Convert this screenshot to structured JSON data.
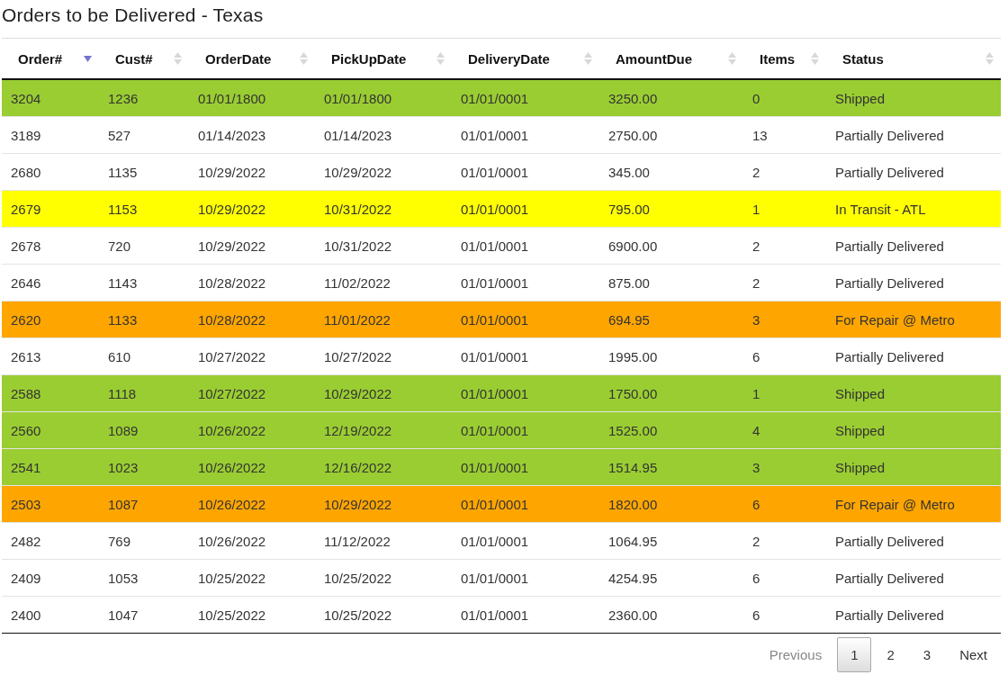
{
  "title": "Orders to be Delivered - Texas",
  "table": {
    "columns": [
      {
        "label": "Order#",
        "sorted": true
      },
      {
        "label": "Cust#",
        "sorted": false
      },
      {
        "label": "OrderDate",
        "sorted": false
      },
      {
        "label": "PickUpDate",
        "sorted": false
      },
      {
        "label": "DeliveryDate",
        "sorted": false
      },
      {
        "label": "AmountDue",
        "sorted": false
      },
      {
        "label": "Items",
        "sorted": false
      },
      {
        "label": "Status",
        "sorted": false
      }
    ],
    "rows": [
      {
        "color": "#9acd32",
        "cells": [
          "3204",
          "1236",
          "01/01/1800",
          "01/01/1800",
          "01/01/0001",
          "3250.00",
          "0",
          "Shipped"
        ]
      },
      {
        "color": "#ffffff",
        "cells": [
          "3189",
          "527",
          "01/14/2023",
          "01/14/2023",
          "01/01/0001",
          "2750.00",
          "13",
          "Partially Delivered"
        ]
      },
      {
        "color": "#ffffff",
        "cells": [
          "2680",
          "1135",
          "10/29/2022",
          "10/29/2022",
          "01/01/0001",
          "345.00",
          "2",
          "Partially Delivered"
        ]
      },
      {
        "color": "#ffff00",
        "cells": [
          "2679",
          "1153",
          "10/29/2022",
          "10/31/2022",
          "01/01/0001",
          "795.00",
          "1",
          "In Transit - ATL"
        ]
      },
      {
        "color": "#ffffff",
        "cells": [
          "2678",
          "720",
          "10/29/2022",
          "10/31/2022",
          "01/01/0001",
          "6900.00",
          "2",
          "Partially Delivered"
        ]
      },
      {
        "color": "#ffffff",
        "cells": [
          "2646",
          "1143",
          "10/28/2022",
          "11/02/2022",
          "01/01/0001",
          "875.00",
          "2",
          "Partially Delivered"
        ]
      },
      {
        "color": "#ffa500",
        "cells": [
          "2620",
          "1133",
          "10/28/2022",
          "11/01/2022",
          "01/01/0001",
          "694.95",
          "3",
          "For Repair @ Metro"
        ]
      },
      {
        "color": "#ffffff",
        "cells": [
          "2613",
          "610",
          "10/27/2022",
          "10/27/2022",
          "01/01/0001",
          "1995.00",
          "6",
          "Partially Delivered"
        ]
      },
      {
        "color": "#9acd32",
        "cells": [
          "2588",
          "1118",
          "10/27/2022",
          "10/29/2022",
          "01/01/0001",
          "1750.00",
          "1",
          "Shipped"
        ]
      },
      {
        "color": "#9acd32",
        "cells": [
          "2560",
          "1089",
          "10/26/2022",
          "12/19/2022",
          "01/01/0001",
          "1525.00",
          "4",
          "Shipped"
        ]
      },
      {
        "color": "#9acd32",
        "cells": [
          "2541",
          "1023",
          "10/26/2022",
          "12/16/2022",
          "01/01/0001",
          "1514.95",
          "3",
          "Shipped"
        ]
      },
      {
        "color": "#ffa500",
        "cells": [
          "2503",
          "1087",
          "10/26/2022",
          "10/29/2022",
          "01/01/0001",
          "1820.00",
          "6",
          "For Repair @ Metro"
        ]
      },
      {
        "color": "#ffffff",
        "cells": [
          "2482",
          "769",
          "10/26/2022",
          "11/12/2022",
          "01/01/0001",
          "1064.95",
          "2",
          "Partially Delivered"
        ]
      },
      {
        "color": "#ffffff",
        "cells": [
          "2409",
          "1053",
          "10/25/2022",
          "10/25/2022",
          "01/01/0001",
          "4254.95",
          "6",
          "Partially Delivered"
        ]
      },
      {
        "color": "#ffffff",
        "cells": [
          "2400",
          "1047",
          "10/25/2022",
          "10/25/2022",
          "01/01/0001",
          "2360.00",
          "6",
          "Partially Delivered"
        ]
      }
    ]
  },
  "pagination": {
    "previous": {
      "label": "Previous",
      "disabled": true
    },
    "pages": [
      {
        "label": "1",
        "selected": true
      },
      {
        "label": "2",
        "selected": false
      },
      {
        "label": "3",
        "selected": false
      }
    ],
    "next": {
      "label": "Next",
      "disabled": false
    }
  }
}
